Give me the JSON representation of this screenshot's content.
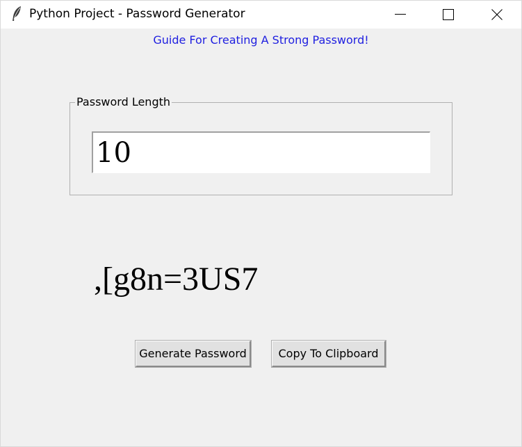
{
  "window": {
    "title": "Python Project - Password Generator",
    "icon": "feather-icon",
    "controls": {
      "minimize": "minimize-icon",
      "maximize": "maximize-icon",
      "close": "close-icon"
    }
  },
  "guide": {
    "link_text": "Guide For Creating A Strong Password!",
    "color": "#2020e0"
  },
  "password_length": {
    "group_label": "Password Length",
    "value": "10"
  },
  "generated_password": ",[g8n=3US7",
  "buttons": {
    "generate_label": "Generate Password",
    "copy_label": "Copy To Clipboard"
  }
}
